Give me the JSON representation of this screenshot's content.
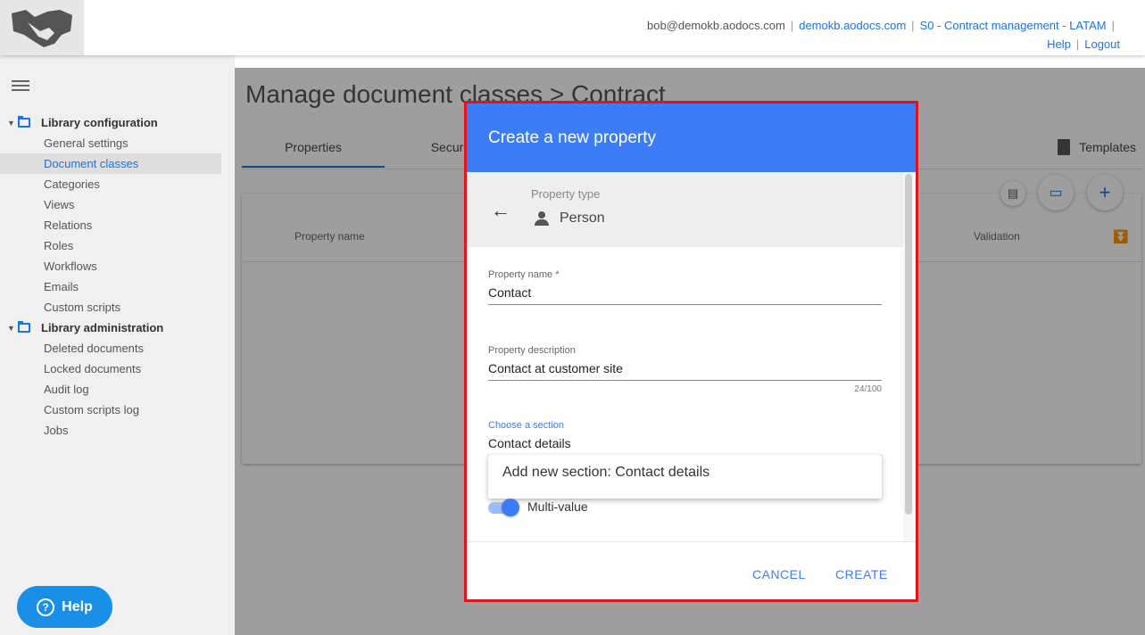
{
  "topbar": {
    "email": "bob@demokb.aodocs.com",
    "domain_link": "demokb.aodocs.com",
    "library_link": "S0 - Contract management - LATAM",
    "help_link": "Help",
    "logout_link": "Logout"
  },
  "sidebar": {
    "sections": [
      {
        "title": "Library configuration",
        "items": [
          "General settings",
          "Document classes",
          "Categories",
          "Views",
          "Relations",
          "Roles",
          "Workflows",
          "Emails",
          "Custom scripts"
        ]
      },
      {
        "title": "Library administration",
        "items": [
          "Deleted documents",
          "Locked documents",
          "Audit log",
          "Custom scripts log",
          "Jobs"
        ]
      }
    ],
    "active_item": "Document classes"
  },
  "main": {
    "title": "Manage document classes > Contract",
    "tabs": [
      "Properties",
      "Secur"
    ],
    "templates_label": "Templates",
    "columns": {
      "property_name": "Property name",
      "validation": "Validation"
    }
  },
  "help_button": {
    "label": "Help",
    "icon": "question-circle-icon"
  },
  "dialog": {
    "title": "Create a new property",
    "property_type_label": "Property type",
    "property_type_value": "Person",
    "fields": {
      "name": {
        "label": "Property name *",
        "value": "Contact"
      },
      "description": {
        "label": "Property description",
        "value": "Contact at customer site",
        "counter": "24/100"
      },
      "section": {
        "label": "Choose a section",
        "value": "Contact details"
      }
    },
    "suggestion": "Add new section: Contact details",
    "multi_value_label": "Multi-value",
    "multi_value_on": true,
    "cancel_label": "CANCEL",
    "create_label": "CREATE"
  },
  "colors": {
    "accent": "#3d7cf7",
    "link": "#1a73e8",
    "highlight_border": "#e0151b"
  }
}
